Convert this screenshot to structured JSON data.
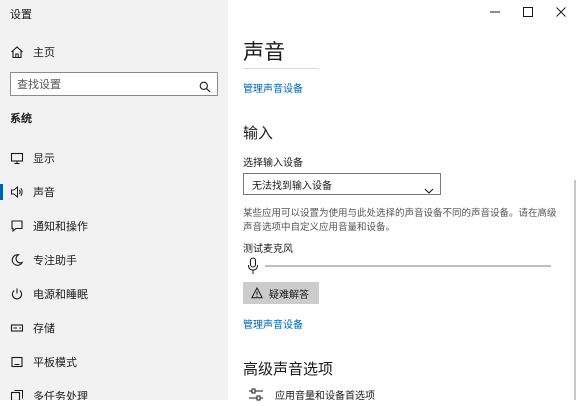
{
  "window": {
    "title": "设置",
    "minimize_icon": "minimize-icon",
    "maximize_icon": "maximize-icon",
    "close_icon": "close-icon"
  },
  "sidebar": {
    "home": {
      "label": "主页",
      "icon": "home-icon"
    },
    "search": {
      "placeholder": "查找设置",
      "icon": "search-icon"
    },
    "section": "系统",
    "items": [
      {
        "label": "显示",
        "icon": "monitor-icon",
        "active": false
      },
      {
        "label": "声音",
        "icon": "speaker-icon",
        "active": true
      },
      {
        "label": "通知和操作",
        "icon": "notification-icon",
        "active": false
      },
      {
        "label": "专注助手",
        "icon": "moon-icon",
        "active": false
      },
      {
        "label": "电源和睡眠",
        "icon": "power-icon",
        "active": false
      },
      {
        "label": "存储",
        "icon": "storage-icon",
        "active": false
      },
      {
        "label": "平板模式",
        "icon": "tablet-icon",
        "active": false
      },
      {
        "label": "多任务处理",
        "icon": "multitask-icon",
        "active": false
      }
    ]
  },
  "main": {
    "title": "声音",
    "manage_devices_link": "管理声音设备",
    "input": {
      "heading": "输入",
      "select_label": "选择输入设备",
      "selected_device": "无法找到输入设备",
      "help_text": "某些应用可以设置为使用与此处选择的声音设备不同的声音设备。请在高级声音选项中自定义应用音量和设备。",
      "test_label": "测试麦克风",
      "mic_level": 0,
      "troubleshoot_label": "疑难解答",
      "manage_devices_link": "管理声音设备"
    },
    "advanced": {
      "heading": "高级声音选项",
      "app_volume_label": "应用音量和设备首选项"
    }
  },
  "colors": {
    "accent": "#0063b1",
    "sidebar_bg": "#f2f2f2",
    "button_bg": "#cccccc"
  }
}
